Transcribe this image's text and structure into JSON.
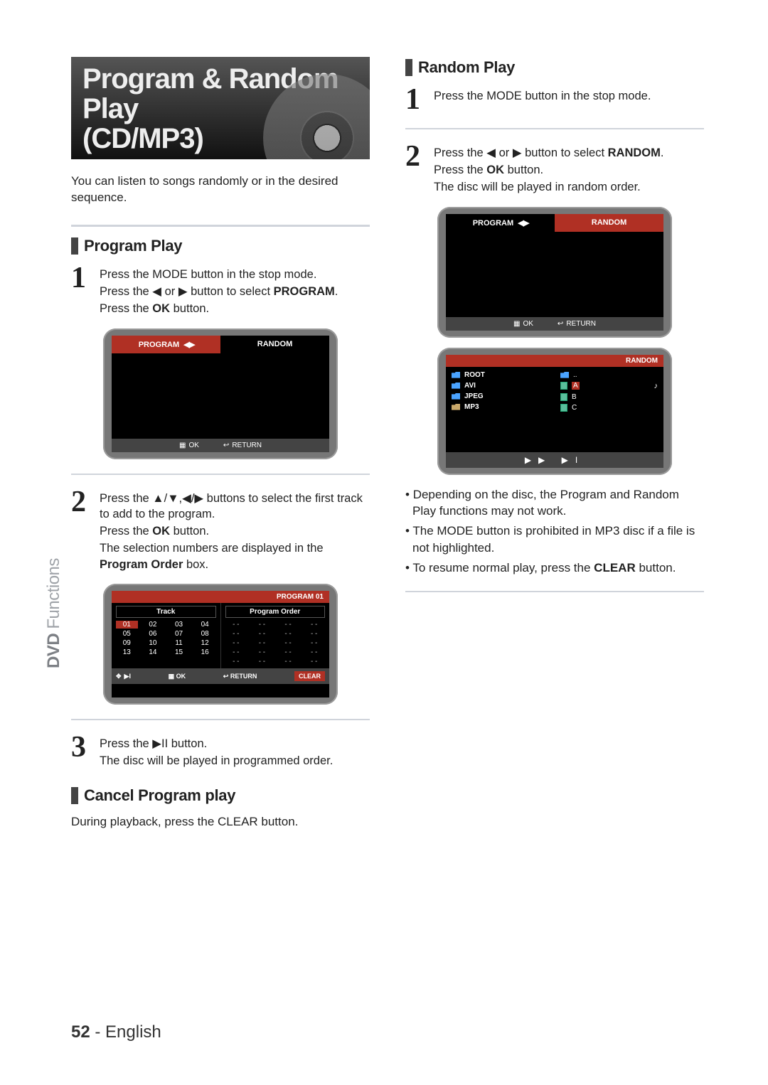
{
  "title": {
    "line1": "Program & Random Play",
    "line2": "(CD/MP3)"
  },
  "intro": "You can listen to songs randomly or in the desired sequence.",
  "side_label": {
    "bold": "DVD",
    "light": " Functions"
  },
  "footer": {
    "page": "52",
    "sep": " - ",
    "lang": "English"
  },
  "program_play": {
    "heading": "Program Play",
    "step1": {
      "l1_a": "Press the MODE button in the stop mode.",
      "l2_a": "Press the ",
      "l2_arr": "◀",
      "l2_b": " or ",
      "l2_arr2": "▶",
      "l2_c": " button to select ",
      "l2_bold": "PROGRAM",
      "l2_d": ".",
      "l3_a": "Press the ",
      "l3_bold": "OK",
      "l3_b": " button."
    },
    "screen1": {
      "tab_program": "PROGRAM",
      "arrows": "◀ ▶",
      "tab_random": "RANDOM",
      "ok": "OK",
      "return": "RETURN"
    },
    "step2": {
      "l1_a": "Press the ",
      "l1_sym": "▲/▼,◀/▶",
      "l1_b": " buttons to select the first track to add to the program.",
      "l2_a": "Press the ",
      "l2_bold": "OK",
      "l2_b": " button.",
      "l3_a": "The selection numbers are displayed in the ",
      "l3_bold": "Program Order",
      "l3_b": " box."
    },
    "screen2": {
      "header": "PROGRAM  01",
      "track_label": "Track",
      "po_label": "Program Order",
      "tracks": [
        "01",
        "02",
        "03",
        "04",
        "05",
        "06",
        "07",
        "08",
        "09",
        "10",
        "11",
        "12",
        "13",
        "14",
        "15",
        "16"
      ],
      "dash": "- -",
      "ok": "OK",
      "return": "RETURN",
      "clear": "CLEAR"
    },
    "step3": {
      "l1_a": "Press the ",
      "l1_sym": "▶II",
      "l1_b": " button.",
      "l2": "The disc will be played in programmed order."
    }
  },
  "cancel": {
    "heading": "Cancel Program play",
    "body": "During playback, press the CLEAR button."
  },
  "random_play": {
    "heading": "Random Play",
    "step1": {
      "l1": "Press the MODE button in the stop mode."
    },
    "step2": {
      "l1_a": "Press the ",
      "l1_arr": "◀",
      "l1_b": " or ",
      "l1_arr2": "▶",
      "l1_c": " button to select ",
      "l1_bold": "RANDOM",
      "l1_d": ".",
      "l2_a": "Press the ",
      "l2_bold": "OK",
      "l2_b": " button.",
      "l3": "The disc will be played in random order."
    },
    "screen1": {
      "tab_program": "PROGRAM",
      "arrows": "◀ ▶",
      "tab_random": "RANDOM",
      "ok": "OK",
      "return": "RETURN"
    },
    "screen2": {
      "header": "RANDOM",
      "left": [
        {
          "icon": "folder",
          "label": "ROOT"
        },
        {
          "icon": "folder",
          "label": "AVI"
        },
        {
          "icon": "folder",
          "label": "JPEG"
        },
        {
          "icon": "open",
          "label": "MP3"
        }
      ],
      "right_up": "..",
      "right": [
        {
          "icon": "file",
          "label": "A",
          "selected": true,
          "note": true
        },
        {
          "icon": "file",
          "label": "B"
        },
        {
          "icon": "file",
          "label": "C"
        }
      ],
      "foot": "▶▶   ▶I"
    },
    "bullets": {
      "b1": "Depending on the disc, the Program and Random Play functions may not work.",
      "b2": "The MODE button is prohibited in MP3 disc if a file is not highlighted.",
      "b3_a": "To resume normal play, press the ",
      "b3_bold": "CLEAR",
      "b3_b": " button."
    }
  }
}
